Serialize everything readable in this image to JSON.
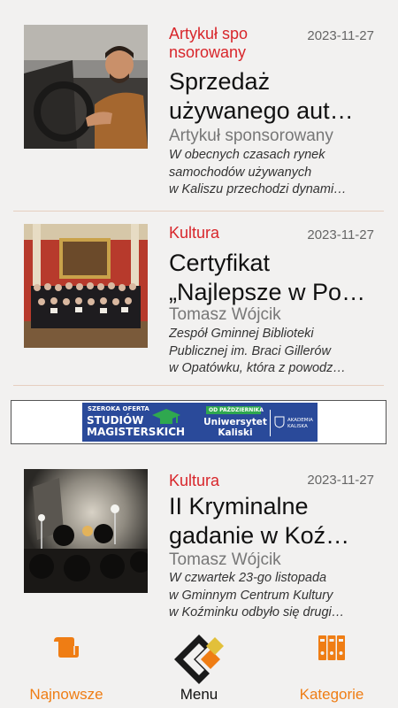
{
  "articles": [
    {
      "category": "Artykuł spo nsorowany",
      "date": "2023-11-27",
      "title_lines": [
        "Sprzedaż",
        "używanego aut…"
      ],
      "author": "Artykuł sponsorowany",
      "excerpt_lines": [
        "W obecnych czasach rynek",
        "samochodów używanych",
        "w Kaliszu przechodzi dynami…"
      ],
      "image": "man-driving-car-photo"
    },
    {
      "category": "Kultura",
      "date": "2023-11-27",
      "title_lines": [
        "Certyfikat",
        "„Najlepsze w Po…"
      ],
      "author": "Tomasz Wójcik",
      "excerpt_lines": [
        "Zespół Gminnej Biblioteki",
        "Publicznej im. Braci Gillerów",
        "w Opatówku, która z powodz…"
      ],
      "image": "group-photo-hall"
    },
    {
      "category": "Kultura",
      "date": "2023-11-27",
      "title_lines": [
        "II Kryminalne",
        "gadanie w Koź…"
      ],
      "author": "Tomasz Wójcik",
      "excerpt_lines": [
        "W czwartek 23-go listopada",
        "w Gminnym Centrum Kultury",
        "w Koźminku odbyło się drugi…"
      ],
      "image": "dark-room-event-photo"
    }
  ],
  "banner": {
    "line1": "SZEROKA OFERTA",
    "line2": "STUDIÓW",
    "line3": "MAGISTERSKICH",
    "tag": "OD PAŹDZIERNIKA",
    "uni1": "Uniwersytet",
    "uni2": "Kaliski",
    "ak1": "AKADEMIA",
    "ak2": "KALISKA"
  },
  "nav": {
    "left": "Najnowsze",
    "center": "Menu",
    "right": "Kategorie"
  },
  "colors": {
    "accent": "#ef7d14",
    "category": "#d8262b",
    "banner_blue": "#2a4a9a"
  }
}
